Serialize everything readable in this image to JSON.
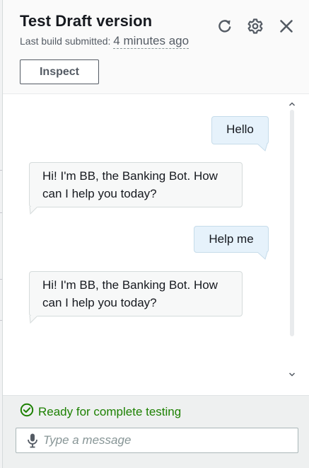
{
  "header": {
    "title": "Test Draft version",
    "last_build_label": "Last build submitted:",
    "last_build_time": "4 minutes ago",
    "inspect_label": "Inspect",
    "icons": [
      "refresh-icon",
      "settings-icon",
      "close-icon"
    ]
  },
  "conversation": {
    "messages": [
      {
        "sender": "user",
        "text": "Hello"
      },
      {
        "sender": "bot",
        "line1": "Hi! I'm BB, the Banking Bot. How",
        "line2": "can I help you today?"
      },
      {
        "sender": "user",
        "text": "Help me"
      },
      {
        "sender": "bot",
        "line1": "Hi! I'm BB, the Banking Bot. How",
        "line2": "can I help you today?"
      }
    ]
  },
  "footer": {
    "status_text": "Ready for complete testing",
    "status_color": "#1d8102",
    "input_placeholder": "Type a message",
    "input_value": ""
  },
  "colors": {
    "user_bubble": "#e6f2fb",
    "bot_bubble": "#f7f8f8",
    "header_bg": "#fafafa",
    "footer_bg": "#eef0f0"
  }
}
